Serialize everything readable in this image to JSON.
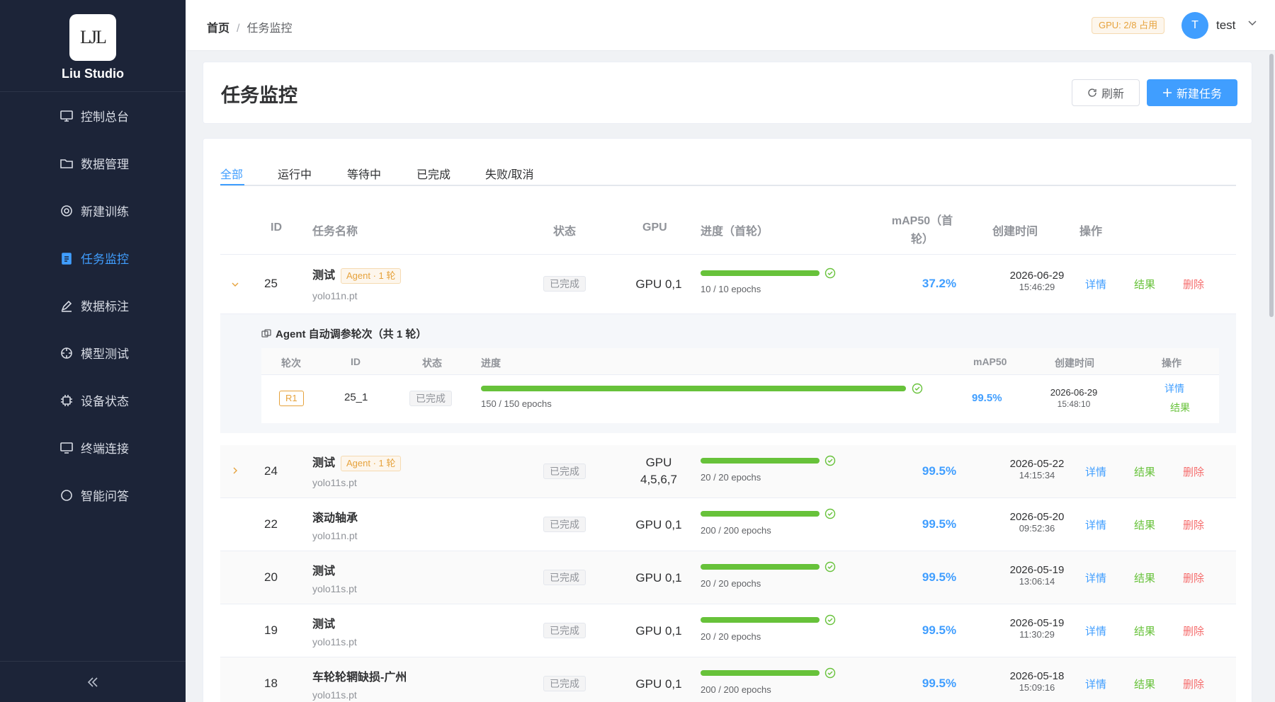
{
  "app": {
    "logo_text": "LJL",
    "brand": "Liu Studio"
  },
  "sidebar": {
    "items": [
      {
        "label": "控制总台",
        "icon": "monitor-icon",
        "active": false
      },
      {
        "label": "数据管理",
        "icon": "folder-icon",
        "active": false
      },
      {
        "label": "新建训练",
        "icon": "gear-icon",
        "active": false
      },
      {
        "label": "任务监控",
        "icon": "clipboard-icon",
        "active": true
      },
      {
        "label": "数据标注",
        "icon": "pen-icon",
        "active": false
      },
      {
        "label": "模型测试",
        "icon": "target-icon",
        "active": false
      },
      {
        "label": "设备状态",
        "icon": "chip-icon",
        "active": false
      },
      {
        "label": "终端连接",
        "icon": "terminal-icon",
        "active": false
      },
      {
        "label": "智能问答",
        "icon": "chat-icon",
        "active": false
      }
    ],
    "collapse_icon": "double-chevron-left-icon"
  },
  "header": {
    "breadcrumb_home": "首页",
    "breadcrumb_sep": "/",
    "breadcrumb_current": "任务监控",
    "gpu_badge": "GPU: 2/8 占用",
    "avatar_letter": "T",
    "username": "test"
  },
  "page": {
    "title": "任务监控",
    "refresh_label": "刷新",
    "new_task_label": "新建任务"
  },
  "tabs": [
    "全部",
    "运行中",
    "等待中",
    "已完成",
    "失败/取消"
  ],
  "table": {
    "headers": {
      "id": "ID",
      "name": "任务名称",
      "status": "状态",
      "gpu": "GPU",
      "progress": "进度（首轮）",
      "map_line1": "mAP50（首",
      "map_line2": "轮）",
      "created": "创建时间",
      "ops": "操作"
    },
    "ops": {
      "detail": "详情",
      "result": "结果",
      "delete": "删除"
    },
    "rows": [
      {
        "id": "25",
        "name": "测试",
        "agent": "Agent · 1 轮",
        "model": "yolo11n.pt",
        "status": "已完成",
        "gpu": "GPU 0,1",
        "epochs": "10 / 10 epochs",
        "progress": 1.0,
        "map": "37.2%",
        "date": "2026-06-29",
        "time": "15:46:29",
        "expanded": true
      },
      {
        "id": "24",
        "name": "测试",
        "agent": "Agent · 1 轮",
        "model": "yolo11s.pt",
        "status": "已完成",
        "gpu": "GPU 4,5,6,7",
        "epochs": "20 / 20 epochs",
        "progress": 1.0,
        "map": "99.5%",
        "date": "2026-05-22",
        "time": "14:15:34",
        "expanded": false
      },
      {
        "id": "22",
        "name": "滚动轴承",
        "agent": "",
        "model": "yolo11n.pt",
        "status": "已完成",
        "gpu": "GPU 0,1",
        "epochs": "200 / 200 epochs",
        "progress": 1.0,
        "map": "99.5%",
        "date": "2026-05-20",
        "time": "09:52:36"
      },
      {
        "id": "20",
        "name": "测试",
        "agent": "",
        "model": "yolo11s.pt",
        "status": "已完成",
        "gpu": "GPU 0,1",
        "epochs": "20 / 20 epochs",
        "progress": 1.0,
        "map": "99.5%",
        "date": "2026-05-19",
        "time": "13:06:14"
      },
      {
        "id": "19",
        "name": "测试",
        "agent": "",
        "model": "yolo11s.pt",
        "status": "已完成",
        "gpu": "GPU 0,1",
        "epochs": "20 / 20 epochs",
        "progress": 1.0,
        "map": "99.5%",
        "date": "2026-05-19",
        "time": "11:30:29"
      },
      {
        "id": "18",
        "name": "车轮轮辋缺损-广州",
        "agent": "",
        "model": "yolo11s.pt",
        "status": "已完成",
        "gpu": "GPU 0,1",
        "epochs": "200 / 200 epochs",
        "progress": 1.0,
        "map": "99.5%",
        "date": "2026-05-18",
        "time": "15:09:16"
      }
    ]
  },
  "agent_rounds": {
    "title": "Agent 自动调参轮次（共 1 轮）",
    "headers": {
      "round": "轮次",
      "id": "ID",
      "status": "状态",
      "progress": "进度",
      "map": "mAP50",
      "created": "创建时间",
      "ops": "操作"
    },
    "rows": [
      {
        "round": "R1",
        "id": "25_1",
        "status": "已完成",
        "epochs": "150 / 150 epochs",
        "progress": 1.0,
        "map": "99.5%",
        "date": "2026-06-29",
        "time": "15:48:10",
        "detail": "详情",
        "result": "结果"
      }
    ]
  },
  "colors": {
    "primary": "#409eff",
    "success": "#67c23a",
    "warning": "#e6a23c",
    "danger": "#f56c6c",
    "sidebar_bg": "#1c2438"
  }
}
